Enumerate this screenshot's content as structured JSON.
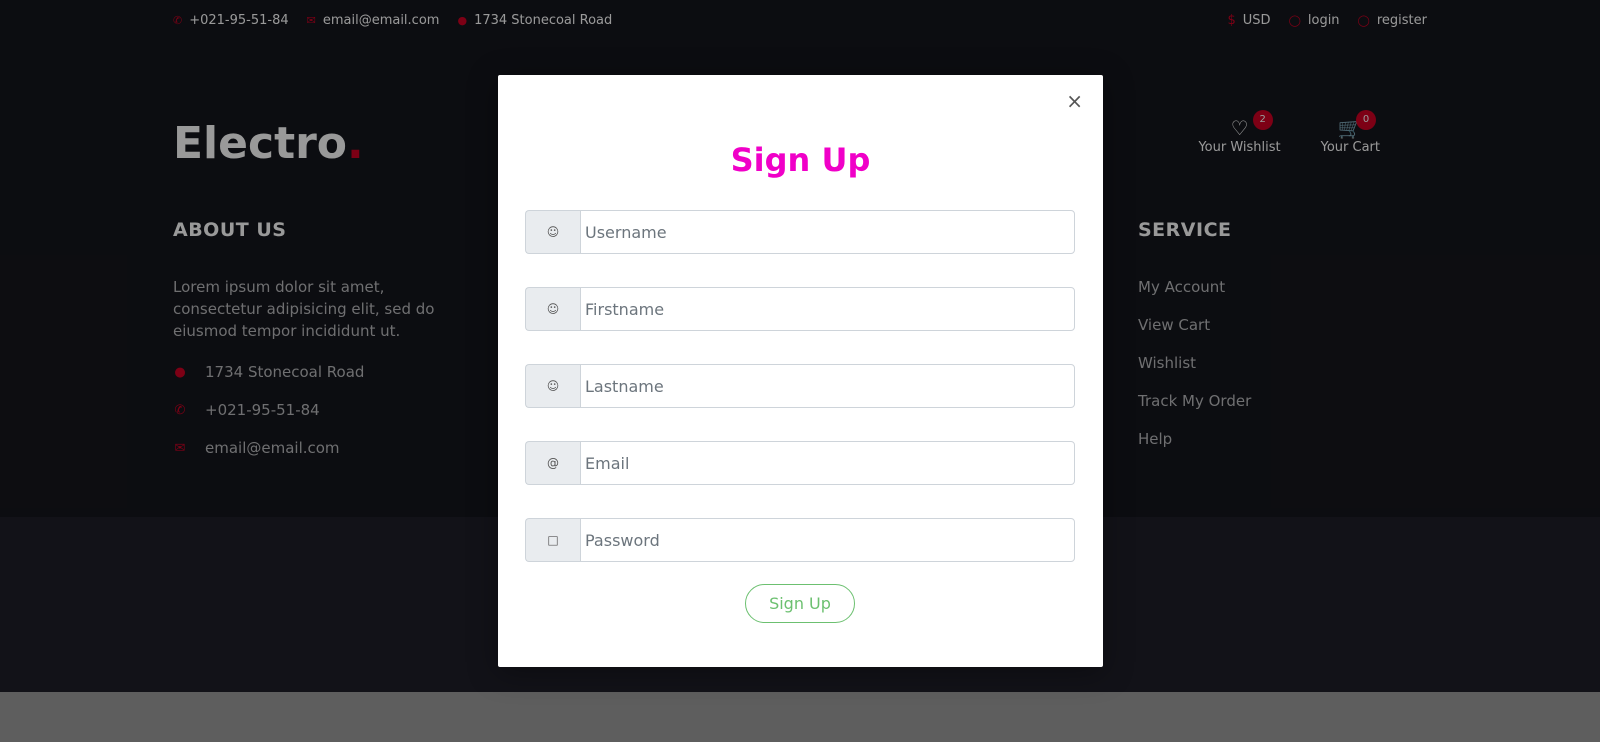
{
  "topbar": {
    "phone": "+021-95-51-84",
    "email": "email@email.com",
    "address": "1734 Stonecoal Road",
    "currency": "USD",
    "login": "login",
    "register": "register"
  },
  "header": {
    "logo_text": "Electro",
    "logo_dot": ".",
    "wishlist_label": "Your Wishlist",
    "wishlist_count": "2",
    "cart_label": "Your Cart",
    "cart_count": "0"
  },
  "footer": {
    "about_title": "ABOUT US",
    "about_text": "Lorem ipsum dolor sit amet, consectetur adipisicing elit, sed do eiusmod tempor incididunt ut.",
    "address": "1734 Stonecoal Road",
    "phone": "+021-95-51-84",
    "email": "email@email.com",
    "service_title": "SERVICE",
    "service_items": [
      "My Account",
      "View Cart",
      "Wishlist",
      "Track My Order",
      "Help"
    ]
  },
  "modal": {
    "title": "Sign Up",
    "close_symbol": "×",
    "fields": {
      "username_placeholder": "Username",
      "firstname_placeholder": "Firstname",
      "lastname_placeholder": "Lastname",
      "email_placeholder": "Email",
      "password_placeholder": "Password"
    },
    "submit_label": "Sign Up"
  },
  "colors": {
    "accent_red": "#d10024",
    "title_magenta": "#f000c8",
    "button_green": "#6cc070"
  }
}
